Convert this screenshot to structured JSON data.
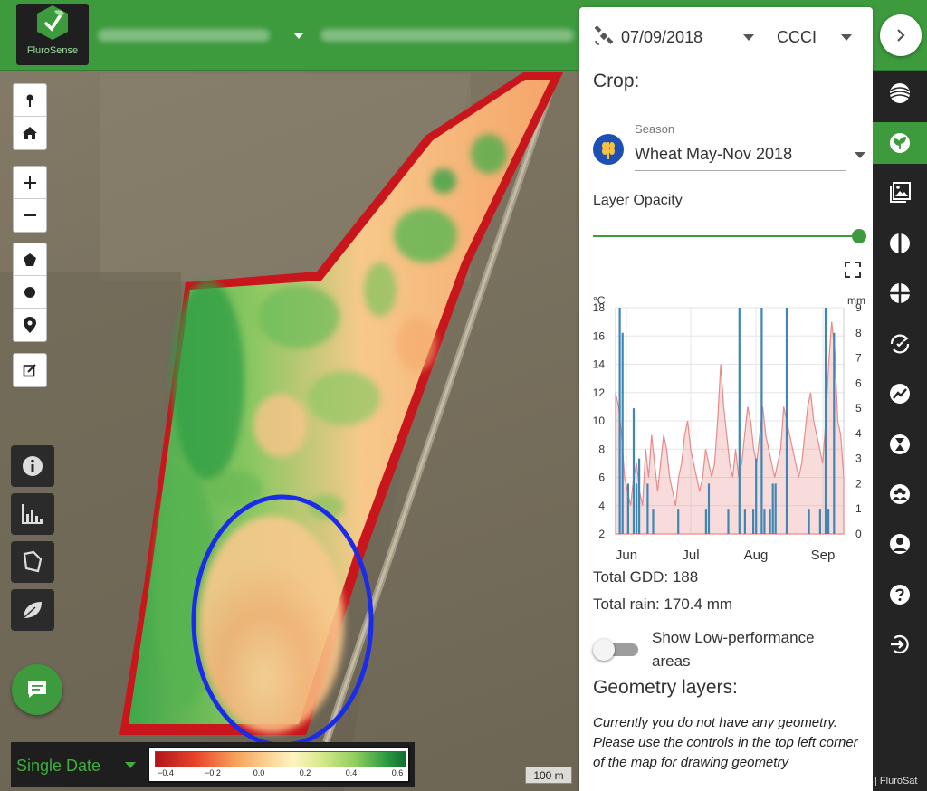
{
  "app": {
    "logo_text": "FluroSense"
  },
  "map": {
    "mode_label": "Single Date",
    "legend_ticks": [
      "−0.4",
      "−0.2",
      "0.0",
      "0.2",
      "0.4",
      "0.6"
    ],
    "scale_label": "100 m",
    "credit": "| FluroSat"
  },
  "panel": {
    "date": "07/09/2018",
    "index": "CCCI",
    "crop_title": "Crop:",
    "season_label": "Season",
    "season_value": "Wheat May-Nov 2018",
    "opacity_label": "Layer Opacity",
    "opacity_value": 1.0,
    "total_gdd": "Total GDD: 188",
    "total_rain": "Total rain: 170.4 mm",
    "low_perf_label": "Show Low-performance areas",
    "geometry_title": "Geometry layers:",
    "geometry_text": "Currently you do not have any geometry. Please use the controls in the top left corner of the map for drawing geometry"
  },
  "chart_data": {
    "type": "bar",
    "left_unit": "°C",
    "right_unit": "mm",
    "left_ticks": [
      "18",
      "16",
      "14",
      "12",
      "10",
      "8",
      "6",
      "4",
      "2"
    ],
    "right_ticks": [
      "9",
      "8",
      "7",
      "6",
      "5",
      "4",
      "3",
      "2",
      "1",
      "0"
    ],
    "months": [
      "Jun",
      "Jul",
      "Aug",
      "Sep"
    ],
    "ylim_temp": [
      2,
      18
    ],
    "ylim_rain": [
      0,
      9
    ],
    "series": [
      {
        "color": "#e88a8a",
        "values": [
          12,
          11,
          9,
          6,
          5,
          4,
          6,
          7,
          5,
          4,
          8,
          6,
          9,
          7,
          5,
          7,
          9,
          8,
          6,
          5,
          4,
          6,
          7,
          9,
          10,
          8,
          7,
          6,
          5,
          6,
          8,
          7,
          6,
          7,
          10,
          14,
          11,
          9,
          7,
          6,
          8,
          6,
          7,
          9,
          11,
          10,
          8,
          7,
          9,
          11,
          9,
          8,
          7,
          6,
          7,
          8,
          11,
          10,
          9,
          8,
          7,
          6,
          7,
          9,
          11,
          12,
          10,
          9,
          8,
          7,
          10,
          14,
          17,
          15,
          10,
          9,
          6
        ]
      },
      {
        "color": "#3f86b4",
        "values": [
          0,
          9,
          8,
          0,
          2,
          0,
          5,
          2,
          3,
          0,
          0,
          2,
          0,
          1,
          0,
          0,
          0,
          0,
          0,
          0,
          0,
          0,
          1,
          0,
          0,
          0,
          0,
          0,
          0,
          0,
          0,
          0,
          1,
          2,
          0,
          0,
          0,
          0,
          0,
          0,
          1,
          0,
          0,
          0,
          9,
          0,
          1,
          0,
          0,
          1,
          3,
          0,
          9,
          1,
          0,
          1,
          2,
          2,
          0,
          0,
          0,
          9,
          0,
          0,
          0,
          0,
          0,
          0,
          0,
          1,
          0,
          0,
          0,
          1,
          0,
          9,
          1,
          0,
          8,
          0,
          0,
          0
        ]
      }
    ]
  }
}
